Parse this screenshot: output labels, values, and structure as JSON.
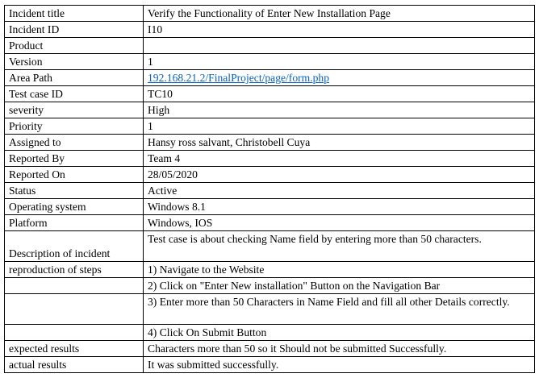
{
  "document": {
    "rows": [
      {
        "label": "Incident title",
        "value": "Verify the Functionality of Enter New Installation Page"
      },
      {
        "label": "Incident ID",
        "value": "I10"
      },
      {
        "label": "Product",
        "value": ""
      },
      {
        "label": "Version",
        "value": "1"
      },
      {
        "label": "Area Path",
        "value": "192.168.21.2/FinalProject/page/form.php",
        "link": true
      },
      {
        "label": "Test case ID",
        "value": "TC10"
      },
      {
        "label": "severity",
        "value": "High"
      },
      {
        "label": "Priority",
        "value": "1"
      },
      {
        "label": "Assigned to",
        "value": "Hansy ross salvant, Christobell Cuya"
      },
      {
        "label": "Reported By",
        "value": "Team 4"
      },
      {
        "label": "Reported On",
        "value": "28/05/2020"
      },
      {
        "label": "Status",
        "value": "Active"
      },
      {
        "label": "Operating system",
        "value": "Windows 8.1"
      },
      {
        "label": "Platform",
        "value": "Windows, IOS"
      },
      {
        "label": "Description of incident",
        "value": "Test case is about checking Name field by entering more than 50 characters.",
        "tall": true
      },
      {
        "label": "reproduction of steps",
        "value": "1) Navigate to the Website"
      },
      {
        "label": "",
        "value": "2) Click on \"Enter New installation\" Button on the Navigation Bar"
      },
      {
        "label": "",
        "value": "3) Enter more than 50 Characters in Name Field and fill all other Details correctly.",
        "tall": true
      },
      {
        "label": "",
        "value": "4) Click On Submit Button"
      },
      {
        "label": "expected results",
        "value": "Characters more than 50 so it Should not be submitted Successfully."
      },
      {
        "label": "actual results",
        "value": "It was submitted successfully."
      }
    ]
  },
  "colors": {
    "link": "#0563c1",
    "border": "#000000",
    "text": "#000000"
  }
}
